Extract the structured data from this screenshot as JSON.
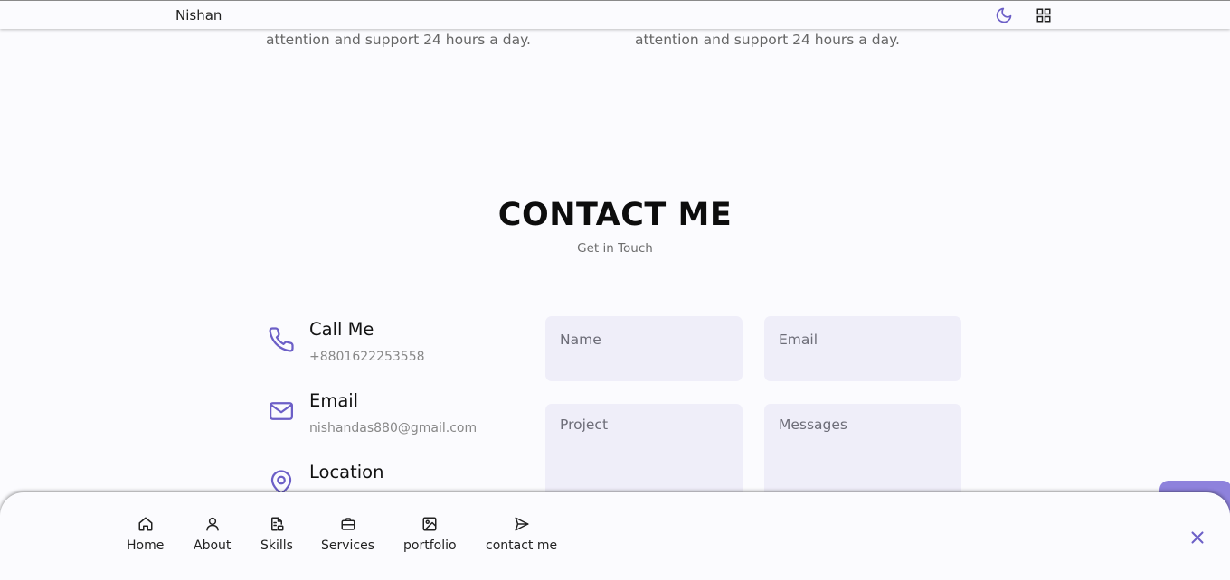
{
  "header": {
    "logo": "Nishan",
    "theme_icon": "moon-icon",
    "menu_icon": "grid-icon"
  },
  "previous_section": {
    "left_text": "attention and support 24 hours a day.",
    "right_text": "attention and support 24 hours a day."
  },
  "contact": {
    "title": "CONTACT ME",
    "subtitle": "Get in Touch",
    "cards": [
      {
        "icon": "phone-icon",
        "title": "Call Me",
        "value": "+8801622253558"
      },
      {
        "icon": "mail-icon",
        "title": "Email",
        "value": "nishandas880@gmail.com"
      },
      {
        "icon": "map-pin-icon",
        "title": "Location",
        "value": ""
      }
    ],
    "form": {
      "name_placeholder": "Name",
      "email_placeholder": "Email",
      "project_placeholder": "Project",
      "messages_placeholder": "Messages"
    }
  },
  "nav": {
    "items": [
      {
        "label": "Home",
        "icon": "home-icon"
      },
      {
        "label": "About",
        "icon": "user-icon"
      },
      {
        "label": "Skills",
        "icon": "file-code-icon"
      },
      {
        "label": "Services",
        "icon": "briefcase-icon"
      },
      {
        "label": "portfolio",
        "icon": "image-icon"
      },
      {
        "label": "contact me",
        "icon": "send-icon"
      }
    ],
    "close_icon": "close-icon"
  },
  "colors": {
    "accent": "#6c5fc7",
    "background": "#fbfbfe",
    "input_bg": "#efeef9"
  }
}
